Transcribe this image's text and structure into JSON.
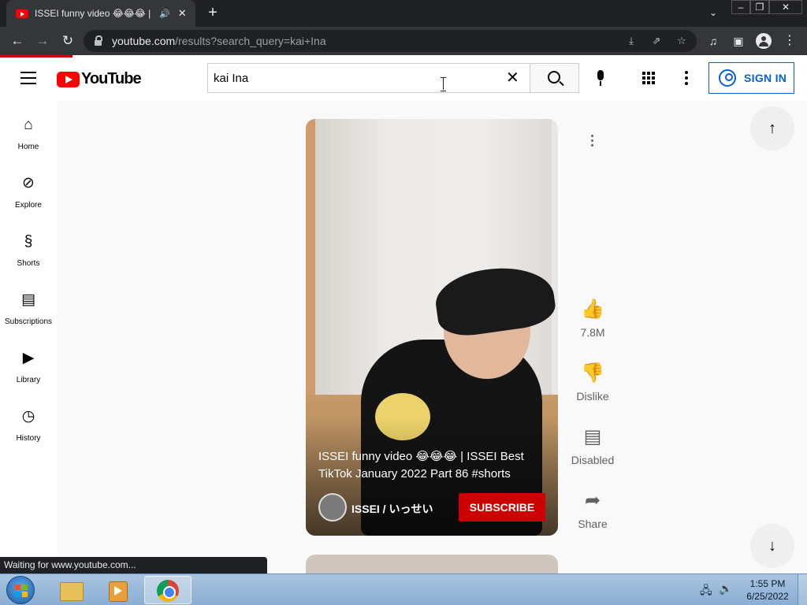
{
  "browser": {
    "tab_title": "ISSEI funny video 😂😂😂 | ISSEI Best TikTok January 2022 Part 86 #shorts",
    "tab_audio_icon": "speaker-icon",
    "url_host": "youtube.com",
    "url_path": "/results?search_query=kai+Ina",
    "status_text": "Waiting for www.youtube.com..."
  },
  "header": {
    "logo_text": "YouTube",
    "search_value": "kai Ina",
    "signin_label": "SIGN IN"
  },
  "sidebar": {
    "items": [
      {
        "label": "Home",
        "icon": "home-icon"
      },
      {
        "label": "Explore",
        "icon": "compass-icon"
      },
      {
        "label": "Shorts",
        "icon": "shorts-icon"
      },
      {
        "label": "Subscriptions",
        "icon": "subscriptions-icon"
      },
      {
        "label": "Library",
        "icon": "library-icon"
      },
      {
        "label": "History",
        "icon": "history-icon"
      }
    ]
  },
  "short": {
    "title": "ISSEI funny video 😂😂😂 | ISSEI Best TikTok January 2022 Part 86 #shorts",
    "channel": "ISSEI / いっせい",
    "subscribe_label": "SUBSCRIBE",
    "actions": {
      "like_label": "7.8M",
      "dislike_label": "Dislike",
      "comments_label": "Disabled",
      "share_label": "Share"
    }
  },
  "taskbar": {
    "time": "1:55 PM",
    "date": "6/25/2022"
  },
  "colors": {
    "brand_red": "#ff0000",
    "subscribe_red": "#cc0000",
    "signin_blue": "#065fd4",
    "chrome_dark": "#202124"
  }
}
